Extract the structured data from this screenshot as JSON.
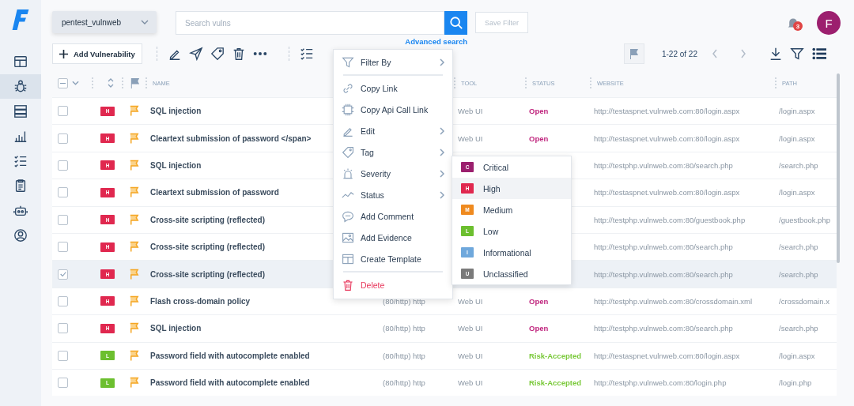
{
  "sidebar": {
    "items": [
      {
        "kind": "dashboard",
        "selected": false
      },
      {
        "kind": "bug",
        "selected": true
      },
      {
        "kind": "servers",
        "selected": false
      },
      {
        "kind": "chart",
        "selected": false
      },
      {
        "kind": "checklist",
        "selected": false
      },
      {
        "kind": "clipboard",
        "selected": false
      },
      {
        "kind": "robot",
        "selected": false
      },
      {
        "kind": "user",
        "selected": false
      }
    ]
  },
  "workspace": "pentest_vulnweb",
  "search": {
    "placeholder": "Search vulns"
  },
  "save_filter": "Save Filter",
  "advanced_search": "Advanced search",
  "notifications": "3",
  "avatar": "F",
  "add_button": "Add Vulnerability",
  "pagination": "1-22 of 22",
  "table": {
    "header_checkbox": {
      "indeterminate": true
    },
    "columns": {
      "name": "NAME",
      "tool": "TOOL",
      "status": "STATUS",
      "website": "WEBSITE",
      "path": "PATH"
    },
    "rows": [
      {
        "checked": false,
        "severity": {
          "letter": "H",
          "color": "#e0284f"
        },
        "flagged": true,
        "name": "SQL injection",
        "tool": "Web UI",
        "status": {
          "label": "Open",
          "color": "#c0267e"
        },
        "website": "http://testaspnet.vulnweb.com:80/login.aspx",
        "path": "/login.aspx"
      },
      {
        "checked": false,
        "severity": {
          "letter": "H",
          "color": "#e0284f"
        },
        "flagged": true,
        "name": "Cleartext submission of password </span>",
        "tool": "Web UI",
        "status": {
          "label": "Open",
          "color": "#c0267e"
        },
        "website": "http://testaspnet.vulnweb.com:80/login.aspx",
        "path": "/login.aspx"
      },
      {
        "checked": false,
        "severity": {
          "letter": "H",
          "color": "#e0284f"
        },
        "flagged": true,
        "name": "SQL injection",
        "website": "http://testphp.vulnweb.com:80/search.php",
        "path": "/search.php"
      },
      {
        "checked": false,
        "severity": {
          "letter": "H",
          "color": "#e0284f"
        },
        "flagged": true,
        "name": "Cleartext submission of password",
        "website": "http://testaspnet.vulnweb.com:80/login.aspx",
        "path": "/login.aspx"
      },
      {
        "checked": false,
        "severity": {
          "letter": "H",
          "color": "#e0284f"
        },
        "flagged": true,
        "name": "Cross-site scripting (reflected)",
        "website": "http://testphp.vulnweb.com:80/guestbook.php",
        "path": "/guestbook.php"
      },
      {
        "checked": false,
        "severity": {
          "letter": "H",
          "color": "#e0284f"
        },
        "flagged": true,
        "name": "Cross-site scripting (reflected)",
        "website": "http://testphp.vulnweb.com:80/search.php",
        "path": "/search.php"
      },
      {
        "checked": true,
        "severity": {
          "letter": "H",
          "color": "#e0284f"
        },
        "flagged": true,
        "name": "Cross-site scripting (reflected)",
        "website": "http://testphp.vulnweb.com:80/search.php",
        "path": "/search.php"
      },
      {
        "checked": false,
        "severity": {
          "letter": "H",
          "color": "#e0284f"
        },
        "flagged": true,
        "name": "Flash cross-domain policy",
        "service": "(80/http) http",
        "tool": "Web UI",
        "status": {
          "label": "Open",
          "color": "#c0267e"
        },
        "website": "http://testphp.vulnweb.com:80/crossdomain.xml",
        "path": "/crossdomain.x"
      },
      {
        "checked": false,
        "severity": {
          "letter": "H",
          "color": "#e0284f"
        },
        "flagged": true,
        "name": "SQL injection",
        "service": "(80/http) http",
        "tool": "Web UI",
        "status": {
          "label": "Open",
          "color": "#c0267e"
        },
        "website": "http://testphp.vulnweb.com:80/search.php",
        "path": "/search.php"
      },
      {
        "checked": false,
        "severity": {
          "letter": "L",
          "color": "#6cbf2f"
        },
        "flagged": true,
        "name": "Password field with autocomplete enabled",
        "service": "(80/http) http",
        "tool": "Web UI",
        "status": {
          "label": "Risk-Accepted",
          "color": "#7ac93a"
        },
        "website": "http://testaspnet.vulnweb.com:80/login.aspx",
        "path": "/login.aspx"
      },
      {
        "checked": false,
        "severity": {
          "letter": "L",
          "color": "#6cbf2f"
        },
        "flagged": true,
        "name": "Password field with autocomplete enabled",
        "service": "(80/http) http",
        "tool": "Web UI",
        "status": {
          "label": "Risk-Accepted",
          "color": "#7ac93a"
        },
        "website": "http://testphp.vulnweb.com:80/login.php",
        "path": "/login.php"
      }
    ]
  },
  "context_menu": {
    "items": [
      {
        "kind": "filter",
        "label": "Filter By",
        "submenu": true,
        "divider_after": true,
        "danger": false
      },
      {
        "kind": "link",
        "label": "Copy Link",
        "submenu": false,
        "divider_after": false,
        "danger": false
      },
      {
        "kind": "api",
        "label": "Copy Api Call Link",
        "submenu": false,
        "divider_after": false,
        "danger": false
      },
      {
        "kind": "edit",
        "label": "Edit",
        "submenu": true,
        "divider_after": false,
        "danger": false
      },
      {
        "kind": "tag",
        "label": "Tag",
        "submenu": true,
        "divider_after": false,
        "danger": false
      },
      {
        "kind": "severity",
        "label": "Severity",
        "submenu": true,
        "divider_after": false,
        "danger": false
      },
      {
        "kind": "status",
        "label": "Status",
        "submenu": true,
        "divider_after": false,
        "danger": false
      },
      {
        "kind": "comment",
        "label": "Add Comment",
        "submenu": false,
        "divider_after": false,
        "danger": false
      },
      {
        "kind": "evidence",
        "label": "Add Evidence",
        "submenu": false,
        "divider_after": false,
        "danger": false
      },
      {
        "kind": "template",
        "label": "Create Template",
        "submenu": false,
        "divider_after": true,
        "danger": false
      },
      {
        "kind": "delete",
        "label": "Delete",
        "submenu": false,
        "divider_after": false,
        "danger": true
      }
    ]
  },
  "severity_menu": {
    "items": [
      {
        "letter": "C",
        "label": "Critical",
        "color": "#9b1f6e",
        "selected": false
      },
      {
        "letter": "H",
        "label": "High",
        "color": "#e0284f",
        "selected": true
      },
      {
        "letter": "M",
        "label": "Medium",
        "color": "#ef8a1f",
        "selected": false
      },
      {
        "letter": "L",
        "label": "Low",
        "color": "#6cbf2f",
        "selected": false
      },
      {
        "letter": "I",
        "label": "Informational",
        "color": "#6fa8dc",
        "selected": false
      },
      {
        "letter": "U",
        "label": "Unclassified",
        "color": "#7a7a7a",
        "selected": false
      }
    ]
  }
}
